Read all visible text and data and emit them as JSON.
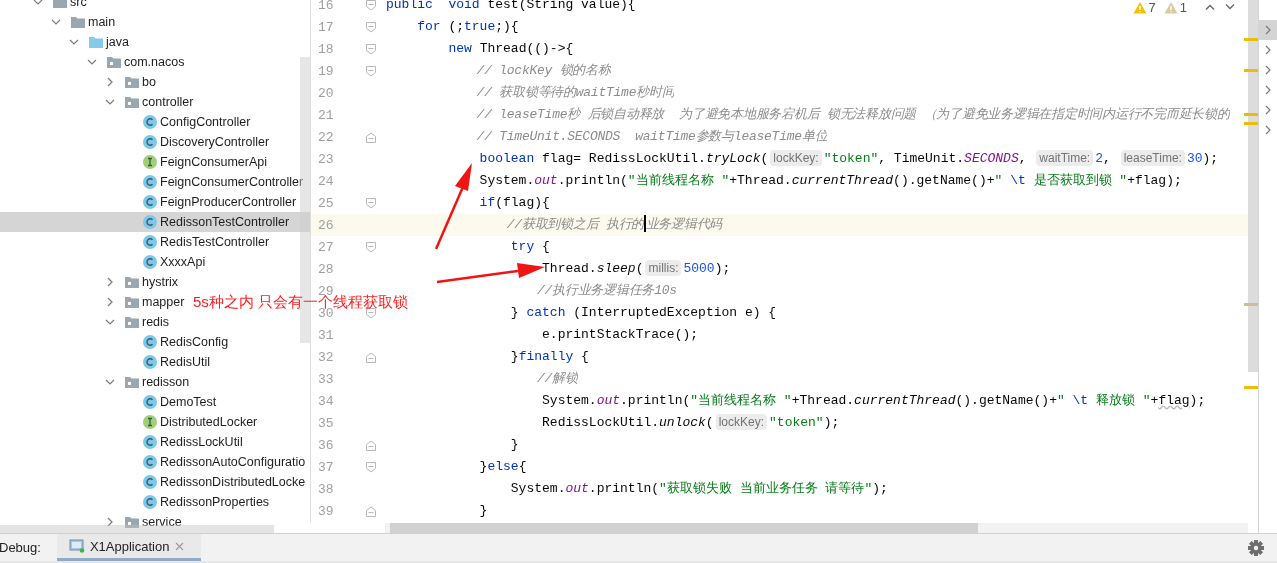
{
  "project_tree": [
    {
      "label": "src",
      "kind": "folder",
      "expanded": true,
      "selected": false,
      "children": [
        {
          "label": "main",
          "kind": "folder",
          "expanded": true,
          "selected": false,
          "children": [
            {
              "label": "java",
              "kind": "source-folder",
              "expanded": true,
              "selected": false,
              "children": [
                {
                  "label": "com.nacos",
                  "kind": "package",
                  "expanded": true,
                  "selected": false,
                  "children": [
                    {
                      "label": "bo",
                      "kind": "package",
                      "expanded": false,
                      "selected": false
                    },
                    {
                      "label": "controller",
                      "kind": "package",
                      "expanded": true,
                      "selected": false,
                      "children": [
                        {
                          "label": "ConfigController",
                          "kind": "class",
                          "selected": false
                        },
                        {
                          "label": "DiscoveryController",
                          "kind": "class",
                          "selected": false
                        },
                        {
                          "label": "FeignConsumerApi",
                          "kind": "interface",
                          "selected": false
                        },
                        {
                          "label": "FeignConsumerController",
                          "kind": "class",
                          "selected": false
                        },
                        {
                          "label": "FeignProducerController",
                          "kind": "class",
                          "selected": false
                        },
                        {
                          "label": "RedissonTestController",
                          "kind": "class",
                          "selected": true
                        },
                        {
                          "label": "RedisTestController",
                          "kind": "class",
                          "selected": false
                        },
                        {
                          "label": "XxxxApi",
                          "kind": "class",
                          "selected": false
                        }
                      ]
                    },
                    {
                      "label": "hystrix",
                      "kind": "package",
                      "expanded": false,
                      "selected": false
                    },
                    {
                      "label": "mapper",
                      "kind": "package",
                      "expanded": false,
                      "selected": false
                    },
                    {
                      "label": "redis",
                      "kind": "package",
                      "expanded": true,
                      "selected": false,
                      "children": [
                        {
                          "label": "RedisConfig",
                          "kind": "class",
                          "selected": false
                        },
                        {
                          "label": "RedisUtil",
                          "kind": "class",
                          "selected": false
                        }
                      ]
                    },
                    {
                      "label": "redisson",
                      "kind": "package",
                      "expanded": true,
                      "selected": false,
                      "children": [
                        {
                          "label": "DemoTest",
                          "kind": "class",
                          "selected": false
                        },
                        {
                          "label": "DistributedLocker",
                          "kind": "interface",
                          "selected": false
                        },
                        {
                          "label": "RedissLockUtil",
                          "kind": "class",
                          "selected": false
                        },
                        {
                          "label": "RedissonAutoConfiguratio",
                          "kind": "class",
                          "selected": false
                        },
                        {
                          "label": "RedissonDistributedLocke",
                          "kind": "class",
                          "selected": false
                        },
                        {
                          "label": "RedissonProperties",
                          "kind": "class",
                          "selected": false
                        }
                      ]
                    },
                    {
                      "label": "service",
                      "kind": "package",
                      "expanded": false,
                      "selected": false
                    }
                  ]
                }
              ]
            }
          ]
        }
      ]
    }
  ],
  "editor": {
    "inspections": [
      {
        "kind": "warning",
        "count": "7"
      },
      {
        "kind": "weak",
        "count": "1"
      }
    ],
    "lines": [
      {
        "number": "16",
        "fold_start": true,
        "fold_end": false,
        "current": false,
        "tokens": [
          {
            "kind": "kw",
            "text": "public  void"
          },
          {
            "kind": "text",
            "text": " test(String value){"
          }
        ]
      },
      {
        "number": "17",
        "fold_start": true,
        "fold_end": false,
        "current": false,
        "tokens": [
          {
            "kind": "kw",
            "text": "    for"
          },
          {
            "kind": "text",
            "text": " (;"
          },
          {
            "kind": "kw",
            "text": "true"
          },
          {
            "kind": "text",
            "text": ";){"
          }
        ]
      },
      {
        "number": "18",
        "fold_start": true,
        "fold_end": false,
        "current": false,
        "tokens": [
          {
            "kind": "kw",
            "text": "        new"
          },
          {
            "kind": "text",
            "text": " Thread(()->{"
          }
        ]
      },
      {
        "number": "19",
        "fold_start": true,
        "fold_end": false,
        "current": false,
        "tokens": [
          {
            "kind": "comment",
            "text": "            // lockKey 锁的名称"
          }
        ]
      },
      {
        "number": "20",
        "fold_start": false,
        "fold_end": false,
        "current": false,
        "tokens": [
          {
            "kind": "comment",
            "text": "            // 获取锁等待的waitTime秒时间"
          }
        ]
      },
      {
        "number": "21",
        "fold_start": false,
        "fold_end": false,
        "current": false,
        "tokens": [
          {
            "kind": "comment",
            "text": "            // leaseTime秒 后锁自动释放  为了避免本地服务宕机后 锁无法释放问题 （为了避免业务逻辑在指定时间内运行不完而延长锁的"
          }
        ]
      },
      {
        "number": "22",
        "fold_start": false,
        "fold_end": true,
        "current": false,
        "tokens": [
          {
            "kind": "comment",
            "text": "            // TimeUnit.SECONDS  waitTime参数与leaseTime单位"
          }
        ]
      },
      {
        "number": "23",
        "fold_start": false,
        "fold_end": false,
        "current": false,
        "tokens": [
          {
            "kind": "kw",
            "text": "            boolean"
          },
          {
            "kind": "text",
            "text": " flag= RedissLockUtil."
          },
          {
            "kind": "static",
            "text": "tryLock"
          },
          {
            "kind": "text",
            "text": "("
          },
          {
            "kind": "hint",
            "text": "lockKey:"
          },
          {
            "kind": "str",
            "text": "\"token\""
          },
          {
            "kind": "text",
            "text": ", TimeUnit."
          },
          {
            "kind": "field",
            "text": "SECONDS"
          },
          {
            "kind": "text",
            "text": ", "
          },
          {
            "kind": "hint",
            "text": "waitTime:"
          },
          {
            "kind": "num",
            "text": "2"
          },
          {
            "kind": "text",
            "text": ", "
          },
          {
            "kind": "hint",
            "text": "leaseTime:"
          },
          {
            "kind": "num",
            "text": "30"
          },
          {
            "kind": "text",
            "text": ");"
          }
        ]
      },
      {
        "number": "24",
        "fold_start": false,
        "fold_end": false,
        "current": false,
        "tokens": [
          {
            "kind": "text",
            "text": "            System."
          },
          {
            "kind": "field",
            "text": "out"
          },
          {
            "kind": "text",
            "text": ".println("
          },
          {
            "kind": "str",
            "text": "\"当前线程名称 \""
          },
          {
            "kind": "text",
            "text": "+Thread."
          },
          {
            "kind": "static",
            "text": "currentThread"
          },
          {
            "kind": "text",
            "text": "().getName()+"
          },
          {
            "kind": "str",
            "text": "\" "
          },
          {
            "kind": "esc",
            "text": "\\t"
          },
          {
            "kind": "str",
            "text": " 是否获取到锁 \""
          },
          {
            "kind": "text",
            "text": "+flag);"
          }
        ]
      },
      {
        "number": "25",
        "fold_start": true,
        "fold_end": false,
        "current": false,
        "tokens": [
          {
            "kind": "kw",
            "text": "            if"
          },
          {
            "kind": "text",
            "text": "(flag){"
          }
        ]
      },
      {
        "number": "26",
        "fold_start": false,
        "fold_end": false,
        "current": true,
        "tokens": [
          {
            "kind": "comment",
            "text": "                //获取到锁之后 执行的"
          },
          {
            "kind": "caret"
          },
          {
            "kind": "comment",
            "text": "业务逻辑代码"
          }
        ]
      },
      {
        "number": "27",
        "fold_start": true,
        "fold_end": false,
        "current": false,
        "tokens": [
          {
            "kind": "kw",
            "text": "                try"
          },
          {
            "kind": "text",
            "text": " {"
          }
        ]
      },
      {
        "number": "28",
        "fold_start": false,
        "fold_end": false,
        "current": false,
        "tokens": [
          {
            "kind": "text",
            "text": "                    Thread."
          },
          {
            "kind": "static",
            "text": "sleep"
          },
          {
            "kind": "text",
            "text": "("
          },
          {
            "kind": "hint",
            "text": "millis:"
          },
          {
            "kind": "num",
            "text": "5000"
          },
          {
            "kind": "text",
            "text": ");"
          }
        ]
      },
      {
        "number": "29",
        "fold_start": false,
        "fold_end": false,
        "current": false,
        "tokens": [
          {
            "kind": "comment",
            "text": "                    //执行业务逻辑任务10s"
          }
        ]
      },
      {
        "number": "30",
        "fold_start": true,
        "fold_end": false,
        "current": false,
        "tokens": [
          {
            "kind": "text",
            "text": "                } "
          },
          {
            "kind": "kw",
            "text": "catch"
          },
          {
            "kind": "text",
            "text": " (InterruptedException e) {"
          }
        ]
      },
      {
        "number": "31",
        "fold_start": false,
        "fold_end": false,
        "current": false,
        "tokens": [
          {
            "kind": "text",
            "text": "                    e.printStackTrace();"
          }
        ]
      },
      {
        "number": "32",
        "fold_start": false,
        "fold_end": true,
        "current": false,
        "tokens": [
          {
            "kind": "text",
            "text": "                }"
          },
          {
            "kind": "kw",
            "text": "finally"
          },
          {
            "kind": "text",
            "text": " {"
          }
        ]
      },
      {
        "number": "33",
        "fold_start": false,
        "fold_end": false,
        "current": false,
        "tokens": [
          {
            "kind": "comment",
            "text": "                    //解锁"
          }
        ]
      },
      {
        "number": "34",
        "fold_start": false,
        "fold_end": false,
        "current": false,
        "tokens": [
          {
            "kind": "text",
            "text": "                    System."
          },
          {
            "kind": "field",
            "text": "out"
          },
          {
            "kind": "text",
            "text": ".println("
          },
          {
            "kind": "str",
            "text": "\"当前线程名称 \""
          },
          {
            "kind": "text",
            "text": "+Thread."
          },
          {
            "kind": "static",
            "text": "currentThread"
          },
          {
            "kind": "text",
            "text": "().getName()+"
          },
          {
            "kind": "str",
            "text": "\" "
          },
          {
            "kind": "esc",
            "text": "\\t"
          },
          {
            "kind": "str",
            "text": " 释放锁 \""
          },
          {
            "kind": "text",
            "text": "+"
          },
          {
            "kind": "warn",
            "text": "flag"
          },
          {
            "kind": "text",
            "text": ");"
          }
        ]
      },
      {
        "number": "35",
        "fold_start": false,
        "fold_end": false,
        "current": false,
        "tokens": [
          {
            "kind": "text",
            "text": "                    RedissLockUtil."
          },
          {
            "kind": "static",
            "text": "unlock"
          },
          {
            "kind": "text",
            "text": "("
          },
          {
            "kind": "hint",
            "text": "lockKey:"
          },
          {
            "kind": "str",
            "text": "\"token\""
          },
          {
            "kind": "text",
            "text": ");"
          }
        ]
      },
      {
        "number": "36",
        "fold_start": false,
        "fold_end": true,
        "current": false,
        "tokens": [
          {
            "kind": "text",
            "text": "                }"
          }
        ]
      },
      {
        "number": "37",
        "fold_start": true,
        "fold_end": false,
        "current": false,
        "tokens": [
          {
            "kind": "text",
            "text": "            }"
          },
          {
            "kind": "kw",
            "text": "else"
          },
          {
            "kind": "text",
            "text": "{"
          }
        ]
      },
      {
        "number": "38",
        "fold_start": false,
        "fold_end": false,
        "current": false,
        "tokens": [
          {
            "kind": "text",
            "text": "                System."
          },
          {
            "kind": "field",
            "text": "out"
          },
          {
            "kind": "text",
            "text": ".println("
          },
          {
            "kind": "str",
            "text": "\"获取锁失败 当前业务任务 请等待\""
          },
          {
            "kind": "text",
            "text": ");"
          }
        ]
      },
      {
        "number": "39",
        "fold_start": false,
        "fold_end": true,
        "current": false,
        "tokens": [
          {
            "kind": "text",
            "text": "            }"
          }
        ]
      }
    ]
  },
  "annotation": {
    "text": "5s种之内 只会有一个线程获取锁"
  },
  "side_panel_arrows": [
    {
      "selected": true
    },
    {
      "selected": false
    },
    {
      "selected": false
    },
    {
      "selected": false
    },
    {
      "selected": false
    },
    {
      "selected": false
    }
  ],
  "debug_bar": {
    "label": "Debug:",
    "tabs": [
      {
        "label": "X1Application",
        "selected": true
      }
    ]
  }
}
